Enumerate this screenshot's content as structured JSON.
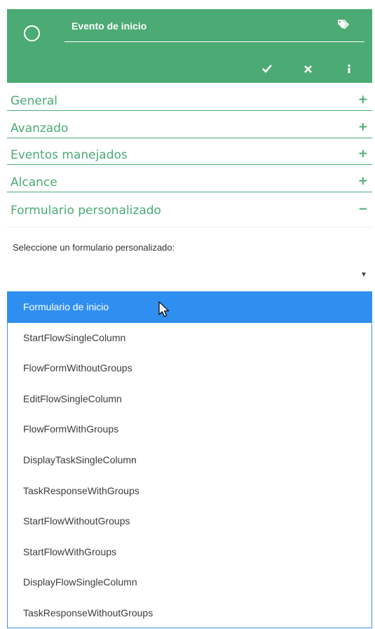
{
  "header": {
    "title": "Evento de inicio",
    "bg_color": "#4caa74",
    "icons": [
      "circle-event-icon",
      "tag-icon",
      "check-icon",
      "close-icon",
      "info-icon"
    ]
  },
  "sections": [
    {
      "label": "General",
      "toggle": "+"
    },
    {
      "label": "Avanzado",
      "toggle": "+"
    },
    {
      "label": "Eventos manejados",
      "toggle": "+"
    },
    {
      "label": "Alcance",
      "toggle": "+"
    },
    {
      "label": "Formulario personalizado",
      "toggle": "−"
    }
  ],
  "custom_form": {
    "field_label": "Seleccione un formulario personalizado:",
    "select_arrow": "▼",
    "options": [
      "Formulario de inicio",
      "StartFlowSingleColumn",
      "FlowFormWithoutGroups",
      "EditFlowSingleColumn",
      "FlowFormWithGroups",
      "DisplayTaskSingleColumn",
      "TaskResponseWithGroups",
      "StartFlowWithoutGroups",
      "StartFlowWithGroups",
      "DisplayFlowSingleColumn",
      "TaskResponseWithoutGroups"
    ],
    "highlighted_option": "Formulario de inicio"
  },
  "colors": {
    "accent": "#4caa74",
    "highlight": "#2f8ff0",
    "dropdown_border": "#3b8ee8"
  }
}
